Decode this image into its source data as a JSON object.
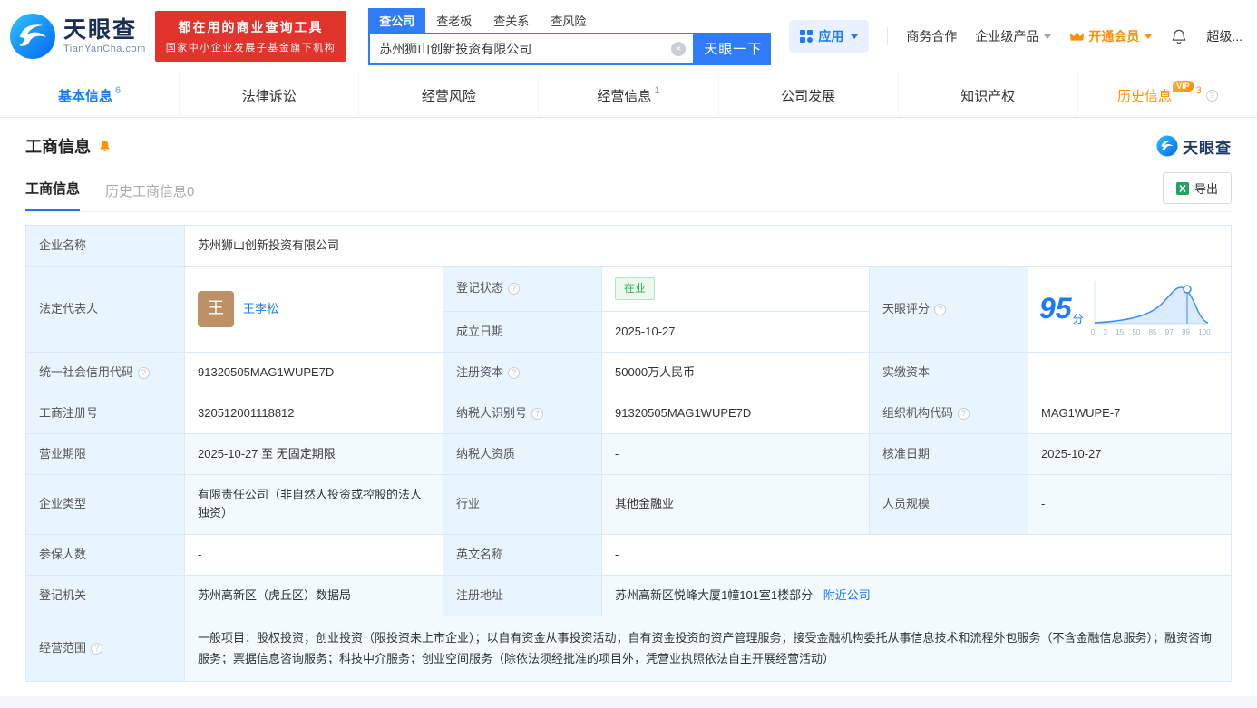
{
  "colors": {
    "accent_blue": "#1a7af8",
    "search_blue": "#2f7cf6",
    "brand_red": "#e0342c",
    "vip_orange": "#ff9000",
    "status_green": "#2bb24c",
    "label_cell_bg": "#e9f5fe"
  },
  "icons": {
    "help_glyph": "?",
    "clear_glyph": "×",
    "logo": "tianyancha-eye-icon",
    "apps": "grid-icon",
    "crown": "crown-icon",
    "bell": "bell-icon",
    "section_bell": "orange-bell-icon",
    "export": "excel-icon",
    "caret": "caret-down-icon"
  },
  "header": {
    "brand_name": "天眼查",
    "brand_domain": "TianYanCha.com",
    "promo_line1": "都在用的商业查询工具",
    "promo_line2": "国家中小企业发展子基金旗下机构",
    "search_tabs": [
      "查公司",
      "查老板",
      "查关系",
      "查风险"
    ],
    "search_value": "苏州狮山创新投资有限公司",
    "search_button": "天眼一下",
    "apps_label": "应用",
    "cooperation_label": "商务合作",
    "enterprise_label": "企业级产品",
    "membership_label": "开通会员",
    "super_label": "超级..."
  },
  "nav_tabs": [
    {
      "label": "基本信息",
      "count": "6"
    },
    {
      "label": "法律诉讼",
      "count": ""
    },
    {
      "label": "经营风险",
      "count": ""
    },
    {
      "label": "经营信息",
      "count": "1"
    },
    {
      "label": "公司发展",
      "count": ""
    },
    {
      "label": "知识产权",
      "count": ""
    },
    {
      "label": "历史信息",
      "count": "3",
      "vip": "VIP"
    }
  ],
  "section": {
    "title": "工商信息",
    "watermark": "天眼查",
    "subtab_active": "工商信息",
    "subtab_history": "历史工商信息0",
    "export_label": "导出"
  },
  "table": {
    "company_name": {
      "label": "企业名称",
      "value": "苏州狮山创新投资有限公司"
    },
    "legal_rep": {
      "label": "法定代表人",
      "value": "王李松",
      "avatar": "王"
    },
    "reg_status": {
      "label": "登记状态",
      "value": "在业"
    },
    "establish_date": {
      "label": "成立日期",
      "value": "2025-10-27"
    },
    "score": {
      "label": "天眼评分"
    },
    "credit_code": {
      "label": "统一社会信用代码",
      "value": "91320505MAG1WUPE7D"
    },
    "reg_capital": {
      "label": "注册资本",
      "value": "50000万人民币"
    },
    "paid_capital": {
      "label": "实缴资本",
      "value": "-"
    },
    "reg_number": {
      "label": "工商注册号",
      "value": "320512001118812"
    },
    "taxpayer_id": {
      "label": "纳税人识别号",
      "value": "91320505MAG1WUPE7D"
    },
    "org_code": {
      "label": "组织机构代码",
      "value": "MAG1WUPE-7"
    },
    "business_term": {
      "label": "营业期限",
      "value": "2025-10-27 至 无固定期限"
    },
    "taxpayer_quality": {
      "label": "纳税人资质",
      "value": "-"
    },
    "approval_date": {
      "label": "核准日期",
      "value": "2025-10-27"
    },
    "company_type": {
      "label": "企业类型",
      "value": "有限责任公司（非自然人投资或控股的法人独资）"
    },
    "industry": {
      "label": "行业",
      "value": "其他金融业"
    },
    "staff_size": {
      "label": "人员规模",
      "value": "-"
    },
    "insured_count": {
      "label": "参保人数",
      "value": "-"
    },
    "english_name": {
      "label": "英文名称",
      "value": "-"
    },
    "registry": {
      "label": "登记机关",
      "value": "苏州高新区（虎丘区）数据局"
    },
    "address": {
      "label": "注册地址",
      "value": "苏州高新区悦峰大厦1幢101室1楼部分",
      "nearby": "附近公司"
    },
    "business_scope": {
      "label": "经营范围",
      "value": "一般项目：股权投资；创业投资（限投资未上市企业）；以自有资金从事投资活动；自有资金投资的资产管理服务；接受金融机构委托从事信息技术和流程外包服务（不含金融信息服务）；融资咨询服务；票据信息咨询服务；科技中介服务；创业空间服务（除依法须经批准的项目外，凭营业执照依法自主开展经营活动）"
    }
  },
  "score_chart": {
    "type": "area",
    "score": "95",
    "unit": "分",
    "x_ticks": [
      "0",
      "3",
      "15",
      "50",
      "85",
      "97",
      "99",
      "100"
    ],
    "marker_score": 95
  }
}
